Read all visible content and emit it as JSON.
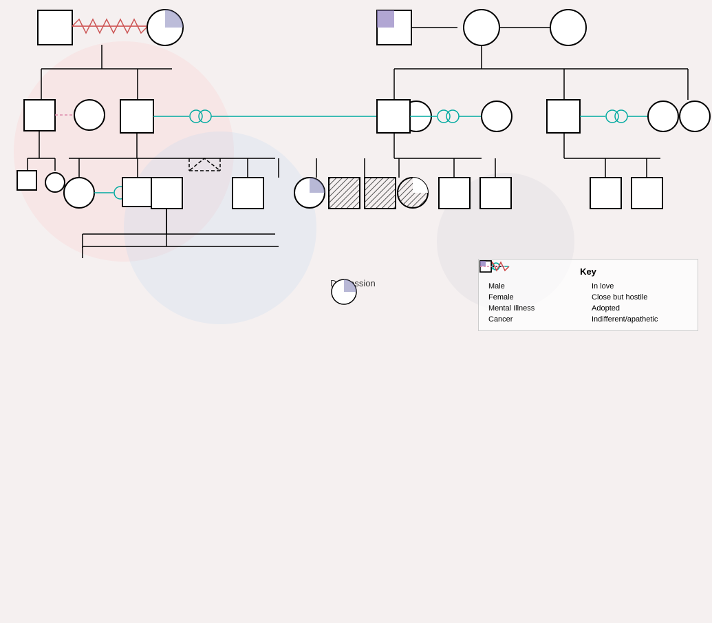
{
  "legend": {
    "title": "Key",
    "items": [
      {
        "label": "Male",
        "type": "square"
      },
      {
        "label": "In love",
        "type": "inlove"
      },
      {
        "label": "Female",
        "type": "circle"
      },
      {
        "label": "Close but hostile",
        "type": "hostile"
      },
      {
        "label": "Mental Illness",
        "type": "hatch"
      },
      {
        "label": "Adopted",
        "type": "adopted"
      },
      {
        "label": "Cancer",
        "type": "cancer"
      },
      {
        "label": "Indifferent/apathetic",
        "type": "indifferent"
      }
    ]
  },
  "depression_label": "Depression"
}
